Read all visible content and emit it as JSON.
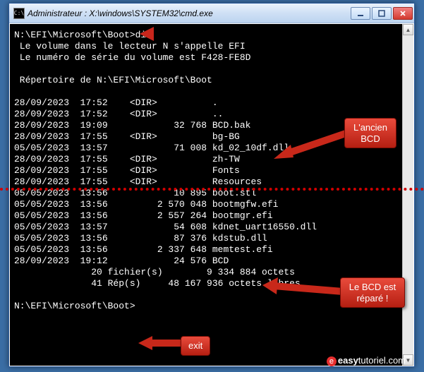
{
  "titlebar": {
    "icon_glyph": "C:\\",
    "title": "Administrateur : X:\\windows\\SYSTEM32\\cmd.exe"
  },
  "terminal": {
    "content": "N:\\EFI\\Microsoft\\Boot>dir\n Le volume dans le lecteur N s'appelle EFI\n Le numéro de série du volume est F428-FE8D\n\n Répertoire de N:\\EFI\\Microsoft\\Boot\n\n28/09/2023  17:52    <DIR>          .\n28/09/2023  17:52    <DIR>          ..\n28/09/2023  19:09            32 768 BCD.bak\n28/09/2023  17:55    <DIR>          bg-BG\n05/05/2023  13:57            71 008 kd_02_10df.dll\n28/09/2023  17:55    <DIR>          zh-TW\n28/09/2023  17:55    <DIR>          Fonts\n28/09/2023  17:55    <DIR>          Resources\n05/05/2023  13:56            10 895 boot.stl\n05/05/2023  13:56         2 570 048 bootmgfw.efi\n05/05/2023  13:56         2 557 264 bootmgr.efi\n05/05/2023  13:57            54 608 kdnet_uart16550.dll\n05/05/2023  13:56            87 376 kdstub.dll\n05/05/2023  13:56         2 337 648 memtest.efi\n28/09/2023  19:12            24 576 BCD\n              20 fichier(s)        9 334 884 octets\n              41 Rép(s)     48 167 936 octets libres\n\nN:\\EFI\\Microsoft\\Boot> "
  },
  "callouts": {
    "dir_arrow": true,
    "ancien_bcd": "L'ancien\nBCD",
    "bcd_repare": "Le BCD est\nréparé !",
    "exit": "exit"
  },
  "watermark": {
    "brand_prefix": "easy",
    "brand_suffix": "tutoriel",
    "tld": ".com"
  }
}
